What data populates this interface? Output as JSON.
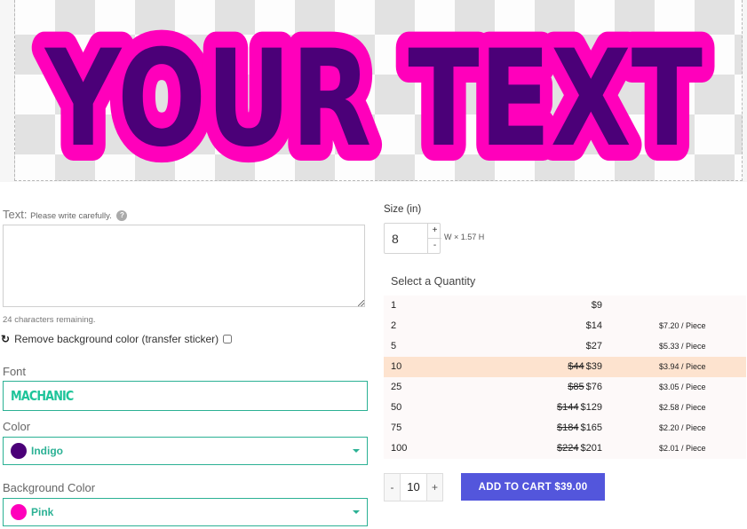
{
  "preview": {
    "sticker_text": "YOUR TEXT",
    "text_color": "#4b0078",
    "outline_color": "#ff00bb"
  },
  "text_field": {
    "label": "Text:",
    "hint": "Please write carefully.",
    "help_icon": "?",
    "value": "",
    "placeholder": "",
    "chars_remaining": "24 characters remaining."
  },
  "remove_background": {
    "icon": "sync-icon",
    "label": "Remove background color (transfer sticker)",
    "checked": false
  },
  "font": {
    "label": "Font",
    "value": "MACHANIC"
  },
  "color": {
    "label": "Color",
    "value": "Indigo",
    "swatch": "#4b0078"
  },
  "background_color": {
    "label": "Background Color",
    "value": "Pink",
    "swatch": "#ff00bb"
  },
  "size": {
    "label": "Size (in)",
    "value": "8",
    "plus": "+",
    "minus": "-",
    "dimensions": "W × 1.57 H"
  },
  "quantity": {
    "title": "Select a Quantity",
    "selected_index": 3,
    "rows": [
      {
        "qty": "1",
        "old_price": "",
        "price": "$9",
        "per_piece": ""
      },
      {
        "qty": "2",
        "old_price": "",
        "price": "$14",
        "per_piece": "$7.20 / Piece"
      },
      {
        "qty": "5",
        "old_price": "",
        "price": "$27",
        "per_piece": "$5.33 / Piece"
      },
      {
        "qty": "10",
        "old_price": "$44",
        "price": "$39",
        "per_piece": "$3.94 / Piece"
      },
      {
        "qty": "25",
        "old_price": "$85",
        "price": "$76",
        "per_piece": "$3.05 / Piece"
      },
      {
        "qty": "50",
        "old_price": "$144",
        "price": "$129",
        "per_piece": "$2.58 / Piece"
      },
      {
        "qty": "75",
        "old_price": "$184",
        "price": "$165",
        "per_piece": "$2.20 / Piece"
      },
      {
        "qty": "100",
        "old_price": "$224",
        "price": "$201",
        "per_piece": "$2.01 / Piece"
      }
    ]
  },
  "cart": {
    "minus": "-",
    "quantity": "10",
    "plus": "+",
    "add_to_cart_label": "ADD TO CART $39.00",
    "button_color": "#5356dc"
  }
}
